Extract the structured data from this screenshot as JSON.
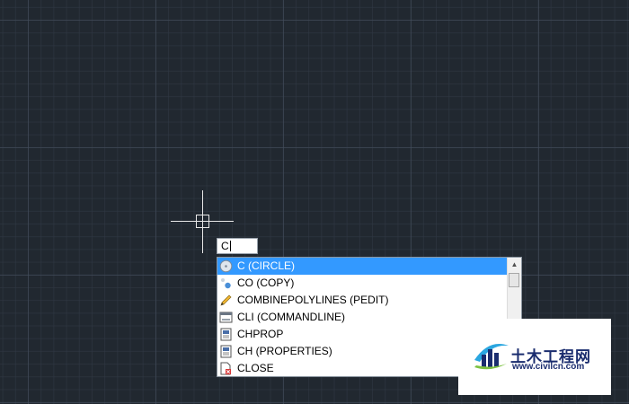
{
  "input": {
    "value": "C"
  },
  "suggestions": [
    {
      "label": "C (CIRCLE)",
      "icon": "circle-icon",
      "selected": true
    },
    {
      "label": "CO (COPY)",
      "icon": "copy-icon"
    },
    {
      "label": "COMBINEPOLYLINES (PEDIT)",
      "icon": "pencil-icon"
    },
    {
      "label": "CLI (COMMANDLINE)",
      "icon": "command-line-icon"
    },
    {
      "label": "CHPROP",
      "icon": "properties-icon"
    },
    {
      "label": "CH (PROPERTIES)",
      "icon": "properties-icon"
    },
    {
      "label": "CLOSE",
      "icon": "close-document-icon"
    }
  ],
  "scrollbar": {
    "up_arrow": "▲"
  },
  "watermark": {
    "name": "土木工程网",
    "url": "www.civilcn.com"
  },
  "colors": {
    "canvas": "#212830",
    "selection": "#3399ff",
    "brand_blue": "#1a2c6e",
    "brand_light_blue": "#2aa6e0",
    "brand_green": "#7dc242"
  }
}
